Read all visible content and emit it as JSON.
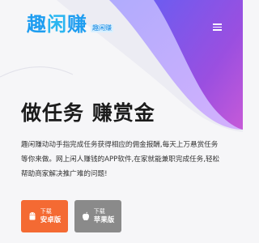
{
  "header": {
    "logo_text": "趣闲赚",
    "logo_sub": "趣闲赚",
    "menu_icon": "hamburger-icon"
  },
  "hero": {
    "headline": "做任务 赚赏金",
    "description": "趣闲赚动动手指完成任务获得相应的佣金报酬,每天上万悬赏任务等你来做。网上闲人赚钱的APP软件,在家就能兼职完成任务,轻松帮助商家解决推广难的问题!"
  },
  "downloads": {
    "android": {
      "small": "下载",
      "label": "安卓版",
      "icon": "android-icon"
    },
    "ios": {
      "small": "下载",
      "label": "苹果版",
      "icon": "apple-icon"
    }
  },
  "colors": {
    "accent_orange": "#f46a33",
    "ios_gray": "#8a8a8a",
    "logo_blue": "#1e9df0",
    "purple": "#8a4fe8"
  }
}
